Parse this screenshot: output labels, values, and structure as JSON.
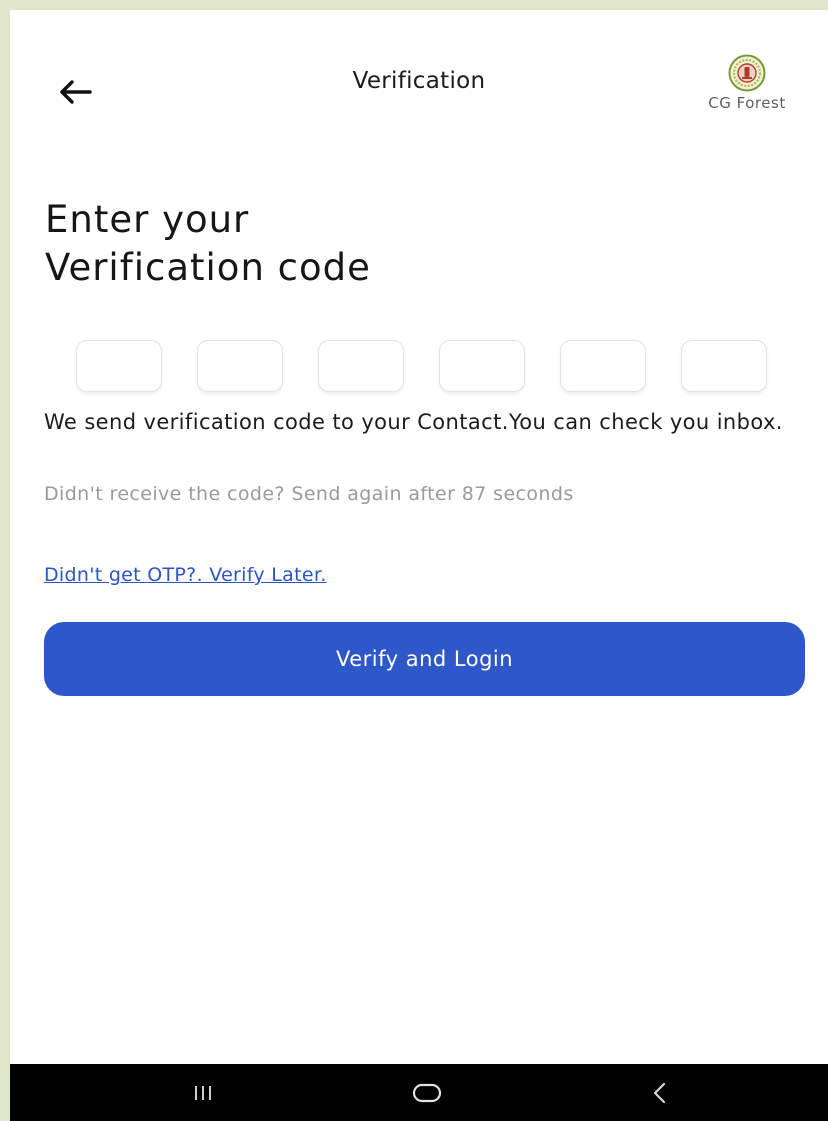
{
  "header": {
    "title": "Verification",
    "brand_name": "CG Forest",
    "back_icon": "arrow-left-icon",
    "emblem_icon": "emblem-logo"
  },
  "main": {
    "heading_line1": "Enter your",
    "heading_line2": "Verification code",
    "otp_digits": [
      "",
      "",
      "",
      "",
      "",
      ""
    ],
    "info_text": "We send verification code to your Contact.You can check you inbox.",
    "resend_text": "Didn't receive the code? Send again after 87 seconds",
    "verify_later_link": "Didn't get OTP?. Verify Later.",
    "submit_label": "Verify and Login"
  },
  "colors": {
    "accent": "#2e57c9",
    "link": "#2b55c4",
    "muted_text": "#9a9a9a",
    "outer_background": "#dfe6c9"
  },
  "system_nav": {
    "items": [
      "recent-apps-icon",
      "home-icon",
      "back-chevron-icon"
    ]
  }
}
